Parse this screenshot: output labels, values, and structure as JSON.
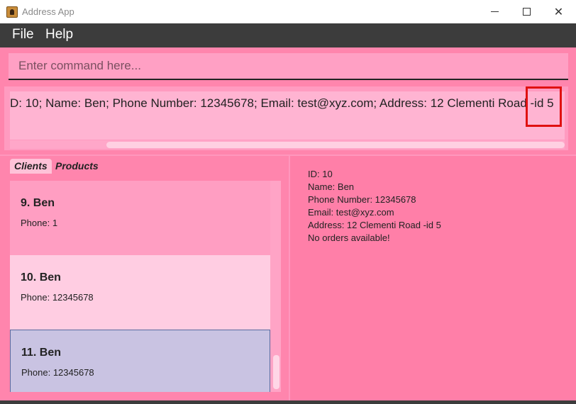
{
  "window": {
    "title": "Address App",
    "minimize_glyph": "",
    "maximize_glyph": "",
    "close_glyph": "✕"
  },
  "menu": {
    "file": "File",
    "help": "Help"
  },
  "command": {
    "placeholder": "Enter command here...",
    "value": ""
  },
  "result": {
    "text": "D: 10; Name: Ben; Phone Number: 12345678; Email: test@xyz.com; Address: 12 Clementi Road -id 5"
  },
  "tabs": [
    {
      "label": "Clients",
      "selected": true
    },
    {
      "label": "Products",
      "selected": false
    }
  ],
  "clients": [
    {
      "index": "9.",
      "name": "Ben",
      "title": "9.  Ben",
      "phone": "Phone: 1",
      "bg": "#ff9ec2"
    },
    {
      "index": "10.",
      "name": "Ben",
      "title": "10.  Ben",
      "phone": "Phone: 12345678",
      "bg": "#ffcde2"
    },
    {
      "index": "11.",
      "name": "Ben",
      "title": "11.  Ben",
      "phone": "Phone: 12345678",
      "bg": "#c9c3e2",
      "selected": true
    }
  ],
  "detail": {
    "id": "ID: 10",
    "name": "Name: Ben",
    "phone": "Phone Number: 12345678",
    "email": "Email: test@xyz.com",
    "address": "Address: 12 Clementi Road -id 5",
    "orders": "No orders available!"
  },
  "colors": {
    "main_bg": "#ff85ad",
    "menubar": "#3c3c3c",
    "highlight": "#e01010",
    "selected_card": "#c9c3e2"
  }
}
